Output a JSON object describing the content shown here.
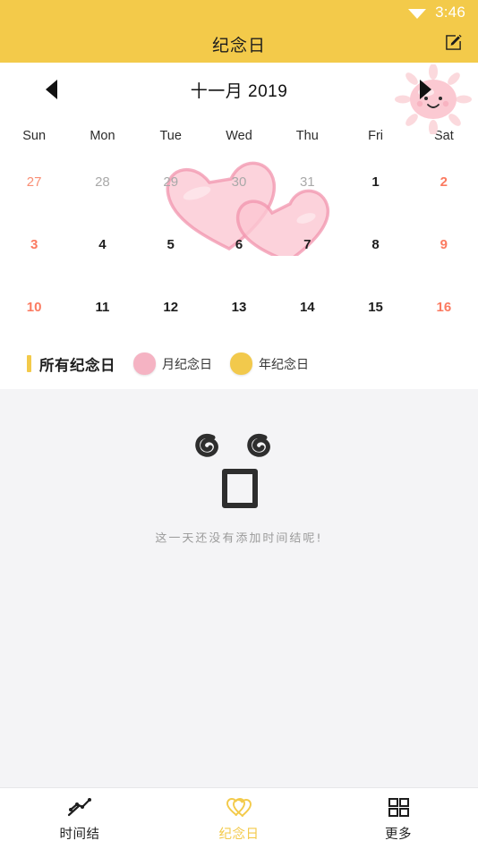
{
  "statusbar": {
    "time": "3:46",
    "wifi_icon": "wifi-icon"
  },
  "appbar": {
    "title": "纪念日",
    "edit_icon": "edit-pencil-icon"
  },
  "calendar": {
    "month_label": "十一月 2019",
    "prev_icon": "triangle-left-icon",
    "next_icon": "triangle-right-icon",
    "sun_decoration": "pink-sun-icon",
    "hearts_decoration": "pink-hearts-icon",
    "weekdays": [
      "Sun",
      "Mon",
      "Tue",
      "Wed",
      "Thu",
      "Fri",
      "Sat"
    ],
    "weeks": [
      [
        {
          "d": "27",
          "cur": false,
          "we": true
        },
        {
          "d": "28",
          "cur": false,
          "we": false
        },
        {
          "d": "29",
          "cur": false,
          "we": false
        },
        {
          "d": "30",
          "cur": false,
          "we": false
        },
        {
          "d": "31",
          "cur": false,
          "we": false
        },
        {
          "d": "1",
          "cur": true,
          "we": false
        },
        {
          "d": "2",
          "cur": true,
          "we": true
        }
      ],
      [
        {
          "d": "3",
          "cur": true,
          "we": true
        },
        {
          "d": "4",
          "cur": true,
          "we": false
        },
        {
          "d": "5",
          "cur": true,
          "we": false
        },
        {
          "d": "6",
          "cur": true,
          "we": false
        },
        {
          "d": "7",
          "cur": true,
          "we": false
        },
        {
          "d": "8",
          "cur": true,
          "we": false
        },
        {
          "d": "9",
          "cur": true,
          "we": true
        }
      ],
      [
        {
          "d": "10",
          "cur": true,
          "we": true
        },
        {
          "d": "11",
          "cur": true,
          "we": false
        },
        {
          "d": "12",
          "cur": true,
          "we": false
        },
        {
          "d": "13",
          "cur": true,
          "we": false
        },
        {
          "d": "14",
          "cur": true,
          "we": false
        },
        {
          "d": "15",
          "cur": true,
          "we": false
        },
        {
          "d": "16",
          "cur": true,
          "we": true
        }
      ]
    ]
  },
  "legend": {
    "title": "所有纪念日",
    "items": [
      {
        "label": "月纪念日",
        "color": "#f5b3c3",
        "swatch": "pink"
      },
      {
        "label": "年纪念日",
        "color": "#f2c94c",
        "swatch": "yellow"
      }
    ]
  },
  "empty": {
    "text": "这一天还没有添加时间结呢!",
    "face_icon": "spiral-eyes-face-icon"
  },
  "bottomnav": {
    "items": [
      {
        "label": "时间结",
        "icon": "timeline-icon",
        "active": false
      },
      {
        "label": "纪念日",
        "icon": "hearts-icon",
        "active": true
      },
      {
        "label": "更多",
        "icon": "grid-icon",
        "active": false
      }
    ]
  },
  "colors": {
    "brand_yellow": "#f3ca4a",
    "weekend_red": "#fb7a60",
    "pink": "#f5b3c3",
    "body_bg": "#f4f4f6"
  }
}
